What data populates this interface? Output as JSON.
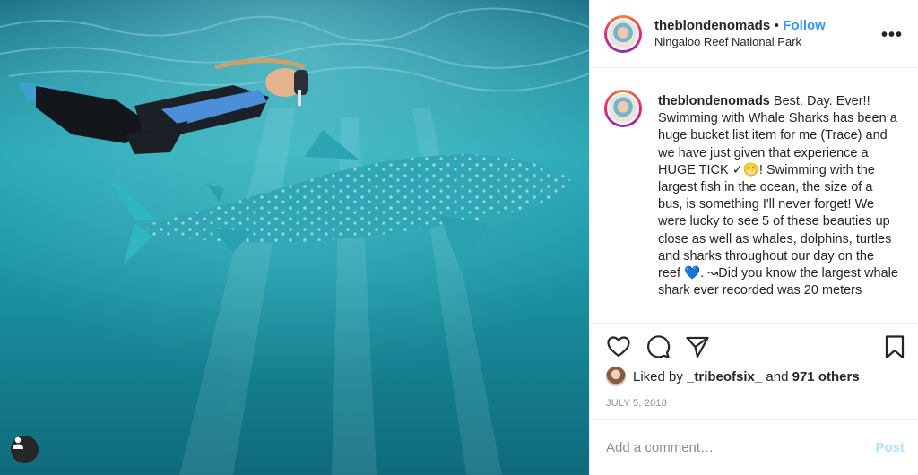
{
  "post": {
    "username": "theblondenomads",
    "separator": "•",
    "follow_label": "Follow",
    "location": "Ningaloo Reef National Park",
    "more_label": "•••",
    "caption_username": "theblondenomads",
    "caption": "Best. Day. Ever!! Swimming with Whale Sharks has been a huge bucket list item for me (Trace) and we have just given that experience a HUGE TICK ✓😁! Swimming with the largest fish in the ocean, the size of a bus, is something I'll never forget! We were lucky to see 5 of these beauties up close as well as whales, dolphins, turtles and sharks throughout our day on the reef 💙. ↝Did you know the largest whale shark ever recorded was 20 meters",
    "likes_prefix": "Liked by",
    "likes_user": "_tribeofsix_",
    "likes_and": "and",
    "likes_others": "971 others",
    "date": "JULY 5, 2018"
  },
  "comment": {
    "placeholder": "Add a comment…",
    "post_label": "Post"
  },
  "icons": {
    "like": "heart-icon",
    "comment": "comment-icon",
    "share": "paper-plane-icon",
    "save": "bookmark-icon",
    "more": "more-options-icon",
    "user_tag": "user-tag-icon"
  },
  "colors": {
    "follow": "#3897f0",
    "post_disabled": "#b2dffc",
    "muted": "#8e8e8e"
  }
}
